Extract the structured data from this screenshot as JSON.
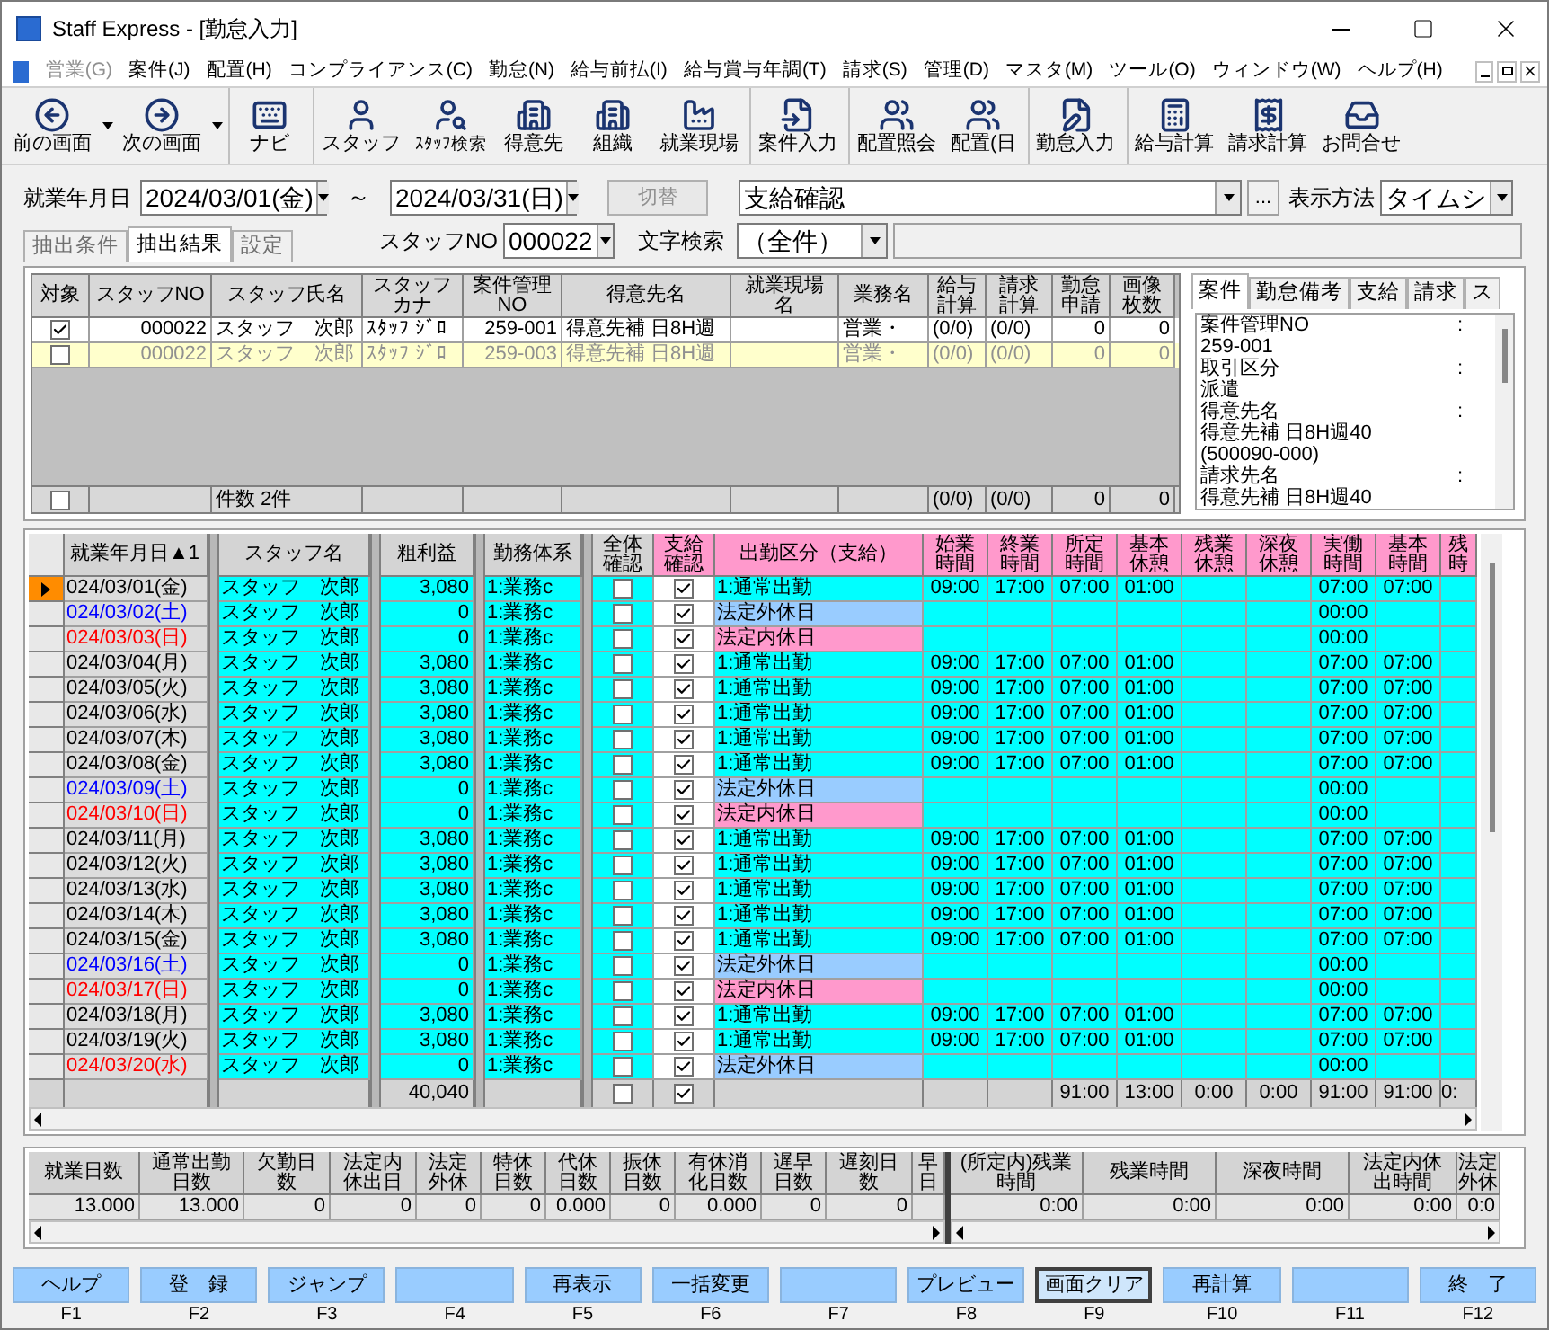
{
  "window": {
    "title": "Staff Express - [勤怠入力]"
  },
  "menu": [
    {
      "label": "営業(G)",
      "disabled": true
    },
    {
      "label": "案件(J)",
      "disabled": false
    },
    {
      "label": "配置(H)",
      "disabled": false
    },
    {
      "label": "コンプライアンス(C)",
      "disabled": false
    },
    {
      "label": "勤怠(N)",
      "disabled": false
    },
    {
      "label": "給与前払(I)",
      "disabled": false
    },
    {
      "label": "給与賞与年調(T)",
      "disabled": false
    },
    {
      "label": "請求(S)",
      "disabled": false
    },
    {
      "label": "管理(D)",
      "disabled": false
    },
    {
      "label": "マスタ(M)",
      "disabled": false
    },
    {
      "label": "ツール(O)",
      "disabled": false
    },
    {
      "label": "ウィンドウ(W)",
      "disabled": false
    },
    {
      "label": "ヘルプ(H)",
      "disabled": false
    }
  ],
  "toolbar": [
    [
      {
        "label": "前の画面",
        "kind": "back",
        "dropdown": true
      },
      {
        "label": "次の画面",
        "kind": "forward",
        "dropdown": true
      }
    ],
    [
      {
        "label": "ナビ",
        "kind": "keyboard",
        "dropdown": false
      }
    ],
    [
      {
        "label": "スタッフ",
        "kind": "person",
        "dropdown": false
      },
      {
        "label": "ｽﾀｯﾌ検索",
        "kind": "person_search",
        "dropdown": false
      },
      {
        "label": "得意先",
        "kind": "building",
        "dropdown": false
      },
      {
        "label": "組織",
        "kind": "building",
        "dropdown": false
      },
      {
        "label": "就業現場",
        "kind": "factory",
        "dropdown": false
      }
    ],
    [
      {
        "label": "案件入力",
        "kind": "file_input",
        "dropdown": false
      }
    ],
    [
      {
        "label": "配置照会",
        "kind": "people",
        "dropdown": false
      },
      {
        "label": "配置(日",
        "kind": "people",
        "dropdown": false
      }
    ],
    [
      {
        "label": "勤怠入力",
        "kind": "edit",
        "dropdown": false
      }
    ],
    [
      {
        "label": "給与計算",
        "kind": "calculator",
        "dropdown": false
      },
      {
        "label": "請求計算",
        "kind": "receipt",
        "dropdown": false
      },
      {
        "label": "お問合せ",
        "kind": "inbox",
        "dropdown": false
      }
    ]
  ],
  "filters": {
    "date_label": "就業年月日",
    "date_from": "2024/03/01(金)",
    "tilde": "～",
    "date_to": "2024/03/31(日)",
    "switch_button": "切替",
    "switch_disabled": true,
    "mode": "支給確認",
    "ellipsis": "...",
    "display_label": "表示方法",
    "display_value": "タイムシ",
    "staff_label": "スタッフNO",
    "staff_value": "000022",
    "search_label": "文字検索",
    "search_value": "（全件）"
  },
  "side_tabs": [
    {
      "label": "抽出条件",
      "selected": false
    },
    {
      "label": "抽出結果",
      "selected": true
    },
    {
      "label": "設定",
      "selected": false
    }
  ],
  "case_table": {
    "columns": [
      {
        "label": "対象"
      },
      {
        "label": "スタッフNO"
      },
      {
        "label": "スタッフ氏名"
      },
      {
        "label": "スタッフカナ"
      },
      {
        "label": "案件管理NO"
      },
      {
        "label": "得意先名"
      },
      {
        "label": "就業現場名"
      },
      {
        "label": "業務名"
      },
      {
        "label": "給与計算"
      },
      {
        "label": "請求計算"
      },
      {
        "label": "勤怠申請"
      },
      {
        "label": "画像枚数"
      }
    ],
    "rows": [
      {
        "checked": true,
        "dimmed": false,
        "staff_no": "000022",
        "name": "スタッフ　次郎",
        "kana": "ｽﾀｯﾌ ｼﾞﾛ",
        "case_no": "259-001",
        "client": "得意先補 日8H週",
        "job": "営業・",
        "pay": "(0/0)",
        "bill": "(0/0)",
        "apply": "0",
        "images": "0"
      },
      {
        "checked": false,
        "dimmed": true,
        "staff_no": "000022",
        "name": "スタッフ　次郎",
        "kana": "ｽﾀｯﾌ ｼﾞﾛ",
        "case_no": "259-003",
        "client": "得意先補 日8H週",
        "job": "営業・",
        "pay": "(0/0)",
        "bill": "(0/0)",
        "apply": "0",
        "images": "0"
      }
    ],
    "footer": {
      "checked": false,
      "name": "件数 2件",
      "pay": "(0/0)",
      "bill": "(0/0)",
      "apply": "0",
      "images": "0"
    }
  },
  "detail_panel": {
    "tabs": [
      {
        "label": "案件",
        "selected": true
      },
      {
        "label": "勤怠備考",
        "selected": false
      },
      {
        "label": "支給",
        "selected": false
      },
      {
        "label": "請求",
        "selected": false
      },
      {
        "label": "ス",
        "selected": false
      }
    ],
    "lines": [
      {
        "text": "案件管理NO",
        "colon": ":"
      },
      {
        "text": "259-001"
      },
      {
        "text": "取引区分",
        "colon": ":"
      },
      {
        "text": "派遣"
      },
      {
        "text": "得意先名",
        "colon": ":"
      },
      {
        "text": "得意先補 日8H週40"
      },
      {
        "text": "(500090-000)"
      },
      {
        "text": "請求先名",
        "colon": ":"
      },
      {
        "text": "得意先補 日8H週40"
      }
    ]
  },
  "grid": {
    "columns": [
      {
        "label": "就業年月日▲1"
      },
      {
        "label": "スタッフ名"
      },
      {
        "label": "粗利益"
      },
      {
        "label": "勤務体系"
      },
      {
        "label": "全体確認"
      },
      {
        "label": "支給確認"
      },
      {
        "label": "出勤区分（支給）"
      },
      {
        "label": "始業時間"
      },
      {
        "label": "終業時間"
      },
      {
        "label": "所定時間"
      },
      {
        "label": "基本休憩"
      },
      {
        "label": "残業休憩"
      },
      {
        "label": "深夜休憩"
      },
      {
        "label": "実働時間"
      },
      {
        "label": "基本時間"
      },
      {
        "label": "残時"
      }
    ],
    "rows": [
      {
        "current": true,
        "color": "#000000",
        "kind": "work",
        "date": "024/03/01(金)",
        "staff": "スタッフ　次郎",
        "profit": "3,080",
        "work_system": "1:業務c",
        "all_confirmed": false,
        "pay_confirmed": true,
        "attendance": "1:通常出勤",
        "start": "09:00",
        "end": "17:00",
        "scheduled": "07:00",
        "basic_break": "01:00",
        "actual": "07:00",
        "basic": "07:00"
      },
      {
        "current": false,
        "color": "#0000ff",
        "kind": "outside_holiday",
        "date": "024/03/02(土)",
        "staff": "スタッフ　次郎",
        "profit": "0",
        "work_system": "1:業務c",
        "all_confirmed": false,
        "pay_confirmed": true,
        "attendance": "法定外休日",
        "actual": "00:00"
      },
      {
        "current": false,
        "color": "#ff0000",
        "kind": "legal_holiday",
        "date": "024/03/03(日)",
        "staff": "スタッフ　次郎",
        "profit": "0",
        "work_system": "1:業務c",
        "all_confirmed": false,
        "pay_confirmed": true,
        "attendance": "法定内休日",
        "actual": "00:00"
      },
      {
        "current": false,
        "color": "#000000",
        "kind": "work",
        "date": "024/03/04(月)",
        "staff": "スタッフ　次郎",
        "profit": "3,080",
        "work_system": "1:業務c",
        "all_confirmed": false,
        "pay_confirmed": true,
        "attendance": "1:通常出勤",
        "start": "09:00",
        "end": "17:00",
        "scheduled": "07:00",
        "basic_break": "01:00",
        "actual": "07:00",
        "basic": "07:00"
      },
      {
        "current": false,
        "color": "#000000",
        "kind": "work",
        "date": "024/03/05(火)",
        "staff": "スタッフ　次郎",
        "profit": "3,080",
        "work_system": "1:業務c",
        "all_confirmed": false,
        "pay_confirmed": true,
        "attendance": "1:通常出勤",
        "start": "09:00",
        "end": "17:00",
        "scheduled": "07:00",
        "basic_break": "01:00",
        "actual": "07:00",
        "basic": "07:00"
      },
      {
        "current": false,
        "color": "#000000",
        "kind": "work",
        "date": "024/03/06(水)",
        "staff": "スタッフ　次郎",
        "profit": "3,080",
        "work_system": "1:業務c",
        "all_confirmed": false,
        "pay_confirmed": true,
        "attendance": "1:通常出勤",
        "start": "09:00",
        "end": "17:00",
        "scheduled": "07:00",
        "basic_break": "01:00",
        "actual": "07:00",
        "basic": "07:00"
      },
      {
        "current": false,
        "color": "#000000",
        "kind": "work",
        "date": "024/03/07(木)",
        "staff": "スタッフ　次郎",
        "profit": "3,080",
        "work_system": "1:業務c",
        "all_confirmed": false,
        "pay_confirmed": true,
        "attendance": "1:通常出勤",
        "start": "09:00",
        "end": "17:00",
        "scheduled": "07:00",
        "basic_break": "01:00",
        "actual": "07:00",
        "basic": "07:00"
      },
      {
        "current": false,
        "color": "#000000",
        "kind": "work",
        "date": "024/03/08(金)",
        "staff": "スタッフ　次郎",
        "profit": "3,080",
        "work_system": "1:業務c",
        "all_confirmed": false,
        "pay_confirmed": true,
        "attendance": "1:通常出勤",
        "start": "09:00",
        "end": "17:00",
        "scheduled": "07:00",
        "basic_break": "01:00",
        "actual": "07:00",
        "basic": "07:00"
      },
      {
        "current": false,
        "color": "#0000ff",
        "kind": "outside_holiday",
        "date": "024/03/09(土)",
        "staff": "スタッフ　次郎",
        "profit": "0",
        "work_system": "1:業務c",
        "all_confirmed": false,
        "pay_confirmed": true,
        "attendance": "法定外休日",
        "actual": "00:00"
      },
      {
        "current": false,
        "color": "#ff0000",
        "kind": "legal_holiday",
        "date": "024/03/10(日)",
        "staff": "スタッフ　次郎",
        "profit": "0",
        "work_system": "1:業務c",
        "all_confirmed": false,
        "pay_confirmed": true,
        "attendance": "法定内休日",
        "actual": "00:00"
      },
      {
        "current": false,
        "color": "#000000",
        "kind": "work",
        "date": "024/03/11(月)",
        "staff": "スタッフ　次郎",
        "profit": "3,080",
        "work_system": "1:業務c",
        "all_confirmed": false,
        "pay_confirmed": true,
        "attendance": "1:通常出勤",
        "start": "09:00",
        "end": "17:00",
        "scheduled": "07:00",
        "basic_break": "01:00",
        "actual": "07:00",
        "basic": "07:00"
      },
      {
        "current": false,
        "color": "#000000",
        "kind": "work",
        "date": "024/03/12(火)",
        "staff": "スタッフ　次郎",
        "profit": "3,080",
        "work_system": "1:業務c",
        "all_confirmed": false,
        "pay_confirmed": true,
        "attendance": "1:通常出勤",
        "start": "09:00",
        "end": "17:00",
        "scheduled": "07:00",
        "basic_break": "01:00",
        "actual": "07:00",
        "basic": "07:00"
      },
      {
        "current": false,
        "color": "#000000",
        "kind": "work",
        "date": "024/03/13(水)",
        "staff": "スタッフ　次郎",
        "profit": "3,080",
        "work_system": "1:業務c",
        "all_confirmed": false,
        "pay_confirmed": true,
        "attendance": "1:通常出勤",
        "start": "09:00",
        "end": "17:00",
        "scheduled": "07:00",
        "basic_break": "01:00",
        "actual": "07:00",
        "basic": "07:00"
      },
      {
        "current": false,
        "color": "#000000",
        "kind": "work",
        "date": "024/03/14(木)",
        "staff": "スタッフ　次郎",
        "profit": "3,080",
        "work_system": "1:業務c",
        "all_confirmed": false,
        "pay_confirmed": true,
        "attendance": "1:通常出勤",
        "start": "09:00",
        "end": "17:00",
        "scheduled": "07:00",
        "basic_break": "01:00",
        "actual": "07:00",
        "basic": "07:00"
      },
      {
        "current": false,
        "color": "#000000",
        "kind": "work",
        "date": "024/03/15(金)",
        "staff": "スタッフ　次郎",
        "profit": "3,080",
        "work_system": "1:業務c",
        "all_confirmed": false,
        "pay_confirmed": true,
        "attendance": "1:通常出勤",
        "start": "09:00",
        "end": "17:00",
        "scheduled": "07:00",
        "basic_break": "01:00",
        "actual": "07:00",
        "basic": "07:00"
      },
      {
        "current": false,
        "color": "#0000ff",
        "kind": "outside_holiday",
        "date": "024/03/16(土)",
        "staff": "スタッフ　次郎",
        "profit": "0",
        "work_system": "1:業務c",
        "all_confirmed": false,
        "pay_confirmed": true,
        "attendance": "法定外休日",
        "actual": "00:00"
      },
      {
        "current": false,
        "color": "#ff0000",
        "kind": "legal_holiday",
        "date": "024/03/17(日)",
        "staff": "スタッフ　次郎",
        "profit": "0",
        "work_system": "1:業務c",
        "all_confirmed": false,
        "pay_confirmed": true,
        "attendance": "法定内休日",
        "actual": "00:00"
      },
      {
        "current": false,
        "color": "#000000",
        "kind": "work",
        "date": "024/03/18(月)",
        "staff": "スタッフ　次郎",
        "profit": "3,080",
        "work_system": "1:業務c",
        "all_confirmed": false,
        "pay_confirmed": true,
        "attendance": "1:通常出勤",
        "start": "09:00",
        "end": "17:00",
        "scheduled": "07:00",
        "basic_break": "01:00",
        "actual": "07:00",
        "basic": "07:00"
      },
      {
        "current": false,
        "color": "#000000",
        "kind": "work",
        "date": "024/03/19(火)",
        "staff": "スタッフ　次郎",
        "profit": "3,080",
        "work_system": "1:業務c",
        "all_confirmed": false,
        "pay_confirmed": true,
        "attendance": "1:通常出勤",
        "start": "09:00",
        "end": "17:00",
        "scheduled": "07:00",
        "basic_break": "01:00",
        "actual": "07:00",
        "basic": "07:00"
      },
      {
        "current": false,
        "color": "#ff0000",
        "kind": "outside_holiday",
        "date": "024/03/20(水)",
        "staff": "スタッフ　次郎",
        "profit": "0",
        "work_system": "1:業務c",
        "all_confirmed": false,
        "pay_confirmed": true,
        "attendance": "法定外休日",
        "actual": "00:00"
      }
    ],
    "totals": {
      "profit": "40,040",
      "all_confirmed": false,
      "pay_confirmed": true,
      "scheduled": "91:00",
      "basic_break": "13:00",
      "overtime_break": "0:00",
      "night_break": "0:00",
      "actual": "91:00",
      "basic": "91:00",
      "column_16": "0:"
    }
  },
  "summary": {
    "left": [
      {
        "label": "就業日数",
        "value": "13.000"
      },
      {
        "label": "通常出勤日数",
        "value": "13.000"
      },
      {
        "label": "欠勤日数",
        "value": "0"
      },
      {
        "label": "法定内休出日",
        "value": "0"
      },
      {
        "label": "法定外休",
        "value": "0"
      },
      {
        "label": "特休日数",
        "value": "0"
      },
      {
        "label": "代休日数",
        "value": "0.000"
      },
      {
        "label": "振休日数",
        "value": "0"
      },
      {
        "label": "有休消化日数",
        "value": "0.000"
      },
      {
        "label": "遅早日数",
        "value": "0"
      },
      {
        "label": "遅刻日数",
        "value": "0"
      },
      {
        "label": "早日"
      }
    ],
    "right": [
      {
        "label": "(所定内)残業時間",
        "value": "0:00"
      },
      {
        "label": "残業時間",
        "value": "0:00"
      },
      {
        "label": "深夜時間",
        "value": "0:00"
      },
      {
        "label": "法定内休出時間",
        "value": "0:00"
      },
      {
        "label": "法定外休",
        "value": "0:0"
      }
    ]
  },
  "function_keys": [
    {
      "label": "ヘルプ",
      "key": "F1",
      "focused": false
    },
    {
      "label": "登　録",
      "key": "F2",
      "focused": false
    },
    {
      "label": "ジャンプ",
      "key": "F3",
      "focused": false
    },
    {
      "key": "F4",
      "focused": false
    },
    {
      "label": "再表示",
      "key": "F5",
      "focused": false
    },
    {
      "label": "一括変更",
      "key": "F6",
      "focused": false
    },
    {
      "key": "F7",
      "focused": false
    },
    {
      "label": "プレビュー",
      "key": "F8",
      "focused": false
    },
    {
      "label": "画面クリア",
      "key": "F9",
      "focused": true
    },
    {
      "label": "再計算",
      "key": "F10",
      "focused": false
    },
    {
      "key": "F11",
      "focused": false
    },
    {
      "label": "終　了",
      "key": "F12",
      "focused": false
    }
  ]
}
